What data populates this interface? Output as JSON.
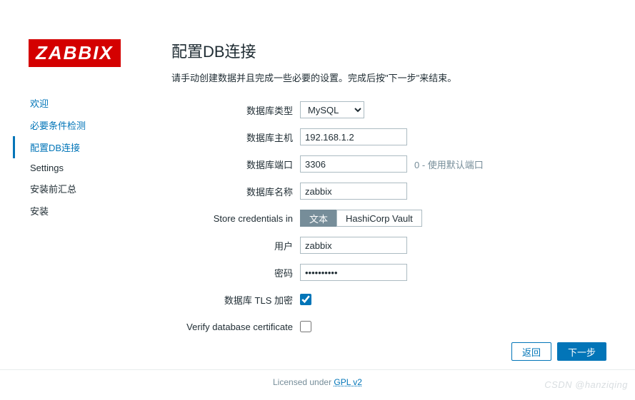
{
  "logo": "ZABBIX",
  "nav": {
    "welcome": "欢迎",
    "prereq": "必要条件检测",
    "dbconfig": "配置DB连接",
    "settings": "Settings",
    "presummary": "安装前汇总",
    "install": "安装"
  },
  "page": {
    "title": "配置DB连接",
    "desc": "请手动创建数据并且完成一些必要的设置。完成后按\"下一步\"来结束。"
  },
  "labels": {
    "dbtype": "数据库类型",
    "dbhost": "数据库主机",
    "dbport": "数据库端口",
    "dbport_hint": "0 - 使用默认端口",
    "dbname": "数据库名称",
    "store": "Store credentials in",
    "store_plain": "文本",
    "store_vault": "HashiCorp Vault",
    "user": "用户",
    "password": "密码",
    "tls": "数据库 TLS 加密",
    "verify": "Verify database certificate"
  },
  "values": {
    "dbtype": "MySQL",
    "dbhost": "192.168.1.2",
    "dbport": "3306",
    "dbname": "zabbix",
    "user": "zabbix",
    "password": "••••••••••",
    "tls_checked": true,
    "verify_checked": false
  },
  "buttons": {
    "back": "返回",
    "next": "下一步"
  },
  "license": {
    "prefix": "Licensed under ",
    "link": "GPL v2"
  },
  "watermark": "CSDN @hanziqing"
}
